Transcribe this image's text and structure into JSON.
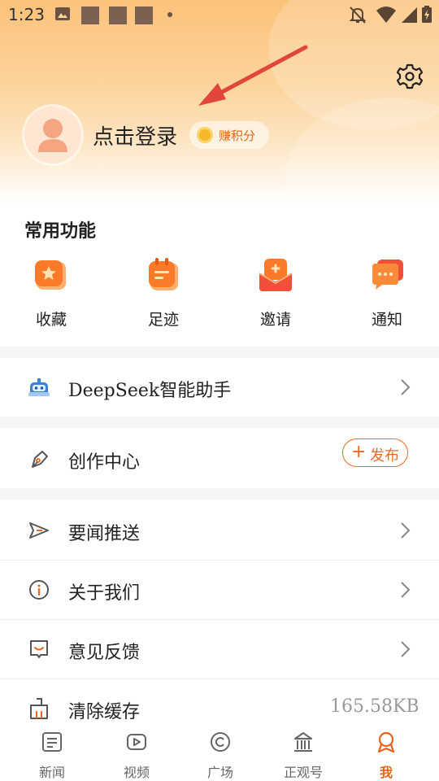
{
  "status_bar": {
    "time": "1:23"
  },
  "profile": {
    "login_label": "点击登录",
    "points_label": "赚积分"
  },
  "common_functions": {
    "title": "常用功能",
    "items": [
      {
        "label": "收藏",
        "icon": "star-folder-icon"
      },
      {
        "label": "足迹",
        "icon": "clipboard-icon"
      },
      {
        "label": "邀请",
        "icon": "invite-icon"
      },
      {
        "label": "通知",
        "icon": "message-icon"
      }
    ]
  },
  "menu": {
    "deepseek": "DeepSeek智能助手",
    "creation_center": "创作中心",
    "publish_label": "发布",
    "push": "要闻推送",
    "about": "关于我们",
    "feedback": "意见反馈",
    "clear_cache": "清除缓存",
    "cache_size": "165.58KB"
  },
  "tabs": [
    {
      "label": "新闻",
      "icon": "news-icon",
      "active": false
    },
    {
      "label": "视频",
      "icon": "video-icon",
      "active": false
    },
    {
      "label": "广场",
      "icon": "square-icon",
      "active": false
    },
    {
      "label": "正观号",
      "icon": "building-icon",
      "active": false
    },
    {
      "label": "我",
      "icon": "me-icon",
      "active": true
    }
  ],
  "colors": {
    "accent": "#e8641a",
    "header": "#fcc27a"
  }
}
